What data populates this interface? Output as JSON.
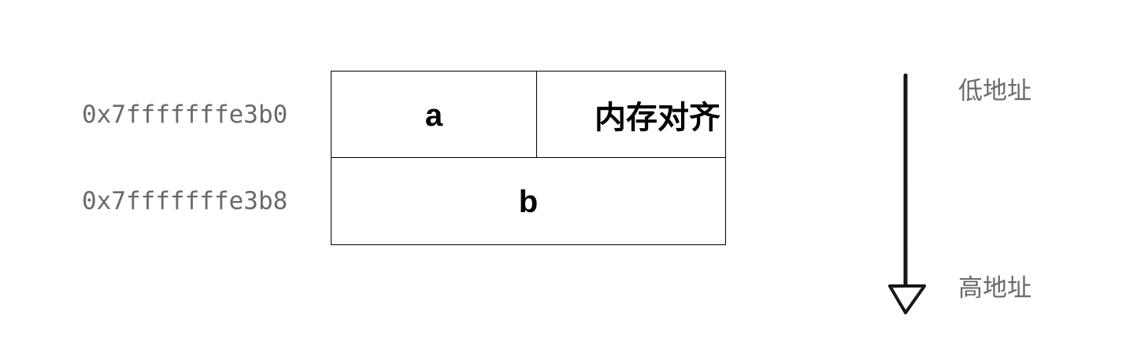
{
  "addresses": {
    "row1": "0x7fffffffe3b0",
    "row2": "0x7fffffffe3b8"
  },
  "memory": {
    "cell_a": "a",
    "cell_padding": "内存对齐",
    "cell_b": "b"
  },
  "direction": {
    "low": "低地址",
    "high": "高地址"
  }
}
